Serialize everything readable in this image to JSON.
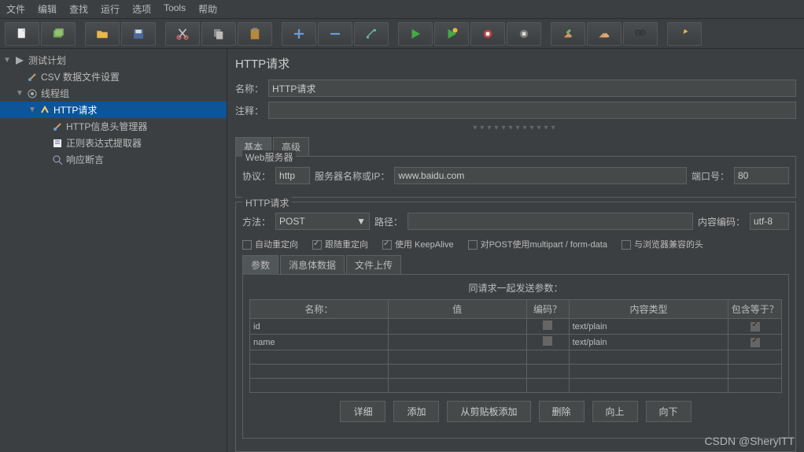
{
  "menu": [
    "文件",
    "编辑",
    "查找",
    "运行",
    "选项",
    "Tools",
    "帮助"
  ],
  "tree": {
    "plan": "测试计划",
    "csv": "CSV 数据文件设置",
    "threadgroup": "线程组",
    "http": "HTTP请求",
    "headermgr": "HTTP信息头管理器",
    "regex": "正则表达式提取器",
    "assert": "响应断言"
  },
  "panel": {
    "title": "HTTP请求",
    "name_label": "名称：",
    "name_value": "HTTP请求",
    "comment_label": "注释：",
    "comment_value": "",
    "tab_basic": "基本",
    "tab_adv": "高级",
    "web_group": "Web服务器",
    "proto_label": "协议：",
    "proto_value": "http",
    "server_label": "服务器名称或IP：",
    "server_value": "www.baidu.com",
    "port_label": "端口号：",
    "port_value": "80",
    "http_group": "HTTP请求",
    "method_label": "方法：",
    "method_value": "POST",
    "path_label": "路径：",
    "path_value": "",
    "enc_label": "内容编码：",
    "enc_value": "utf-8",
    "cb_auto": "自动重定向",
    "cb_follow": "跟随重定向",
    "cb_keep": "使用 KeepAlive",
    "cb_multi": "对POST使用multipart / form-data",
    "cb_compat": "与浏览器兼容的头",
    "ptab_params": "参数",
    "ptab_body": "消息体数据",
    "ptab_files": "文件上传",
    "table_caption": "同请求一起发送参数：",
    "th_name": "名称：",
    "th_value": "值",
    "th_enc": "编码？",
    "th_ctype": "内容类型",
    "th_eq": "包含等于？",
    "rows": [
      {
        "name": "id",
        "value": "",
        "enc": false,
        "ctype": "text/plain",
        "eq": true
      },
      {
        "name": "name",
        "value": "",
        "enc": false,
        "ctype": "text/plain",
        "eq": true
      }
    ],
    "btn_detail": "详细",
    "btn_add": "添加",
    "btn_clip": "从剪贴板添加",
    "btn_del": "删除",
    "btn_up": "向上",
    "btn_down": "向下"
  },
  "watermark": "CSDN @SherylTT"
}
